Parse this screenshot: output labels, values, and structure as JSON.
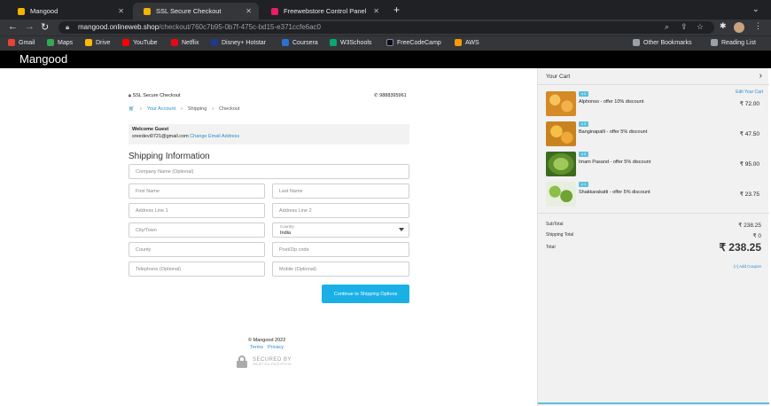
{
  "browser": {
    "tabs": [
      {
        "title": "Mangood",
        "icon_color": "#f4b400"
      },
      {
        "title": "SSL Secure Checkout",
        "icon_color": "#f4b400"
      },
      {
        "title": "Freewebstore Control Panel",
        "icon_color": "#e91e63"
      }
    ],
    "url_host": "mangood.onlineweb.shop",
    "url_path": "/checkout/760c7b95-0b7f-475c-bd15-e371ccfe6ac0",
    "bookmarks": [
      {
        "label": "Gmail",
        "color": "#ea4335"
      },
      {
        "label": "Maps",
        "color": "#34a853"
      },
      {
        "label": "Drive",
        "color": "#fbbc04"
      },
      {
        "label": "YouTube",
        "color": "#ff0000"
      },
      {
        "label": "Netflix",
        "color": "#e50914"
      },
      {
        "label": "Disney+ Hotstar",
        "color": "#1f3a8a"
      },
      {
        "label": "Coursera",
        "color": "#2a73cc"
      },
      {
        "label": "W3Schools",
        "color": "#04aa6d"
      },
      {
        "label": "FreeCodeCamp",
        "color": "#0a0a23"
      },
      {
        "label": "AWS",
        "color": "#ff9900"
      }
    ],
    "other_bookmarks": "Other Bookmarks",
    "reading_list": "Reading List"
  },
  "site": {
    "brand": "Mangood"
  },
  "checkout": {
    "secure_label": "SSL Secure Checkout",
    "phone": "9888395961",
    "steps": [
      "Your Account",
      "Shipping",
      "Checkout"
    ],
    "welcome_title": "Welcome Guest",
    "email": "sreedevi0721@gmail.com",
    "change_email": "Change Email Address",
    "section_title": "Shipping Information",
    "fields": {
      "company": "Company Name (Optional)",
      "first_name": "First Name",
      "last_name": "Last Name",
      "address1": "Address Line 1",
      "address2": "Address Line 2",
      "city": "City/Town",
      "country_label": "Country",
      "country_value": "India",
      "county": "County",
      "postcode": "Post/Zip code",
      "telephone": "Telephone (Optional)",
      "mobile": "Mobile (Optional)"
    },
    "continue_label": "Continue to Shipping Options",
    "footer_copy": "© Mangood 2022",
    "footer_terms": "Terms",
    "footer_privacy": "Privacy",
    "secured_by": "SECURED BY",
    "secured_sub": "256 BIT SSL ENCRYPTION"
  },
  "cart": {
    "title": "Your Cart",
    "edit_label": "Edit Your Cart",
    "items": [
      {
        "qty": "x 2",
        "name": "Alphonso - offer 10% discount",
        "price": "₹ 72.00",
        "color": "#e3a03a"
      },
      {
        "qty": "x 2",
        "name": "Banginapalli - offer 5% discount",
        "price": "₹ 47.50",
        "color": "#e8a530"
      },
      {
        "qty": "x 2",
        "name": "Imam Pasand - offer 5% discount",
        "price": "₹ 95.00",
        "color": "#7aa63c"
      },
      {
        "qty": "x 1",
        "name": "Shakkarakatti - offer 5% discount",
        "price": "₹ 23.75",
        "color": "#4f8a2e"
      }
    ],
    "subtotal_label": "SubTotal",
    "subtotal_value": "₹ 238.25",
    "shipping_label": "Shipping Total",
    "shipping_value": "₹ 0",
    "total_label": "Total",
    "total_value": "₹ 238.25",
    "coupon_label": "[+] Add Coupon"
  }
}
